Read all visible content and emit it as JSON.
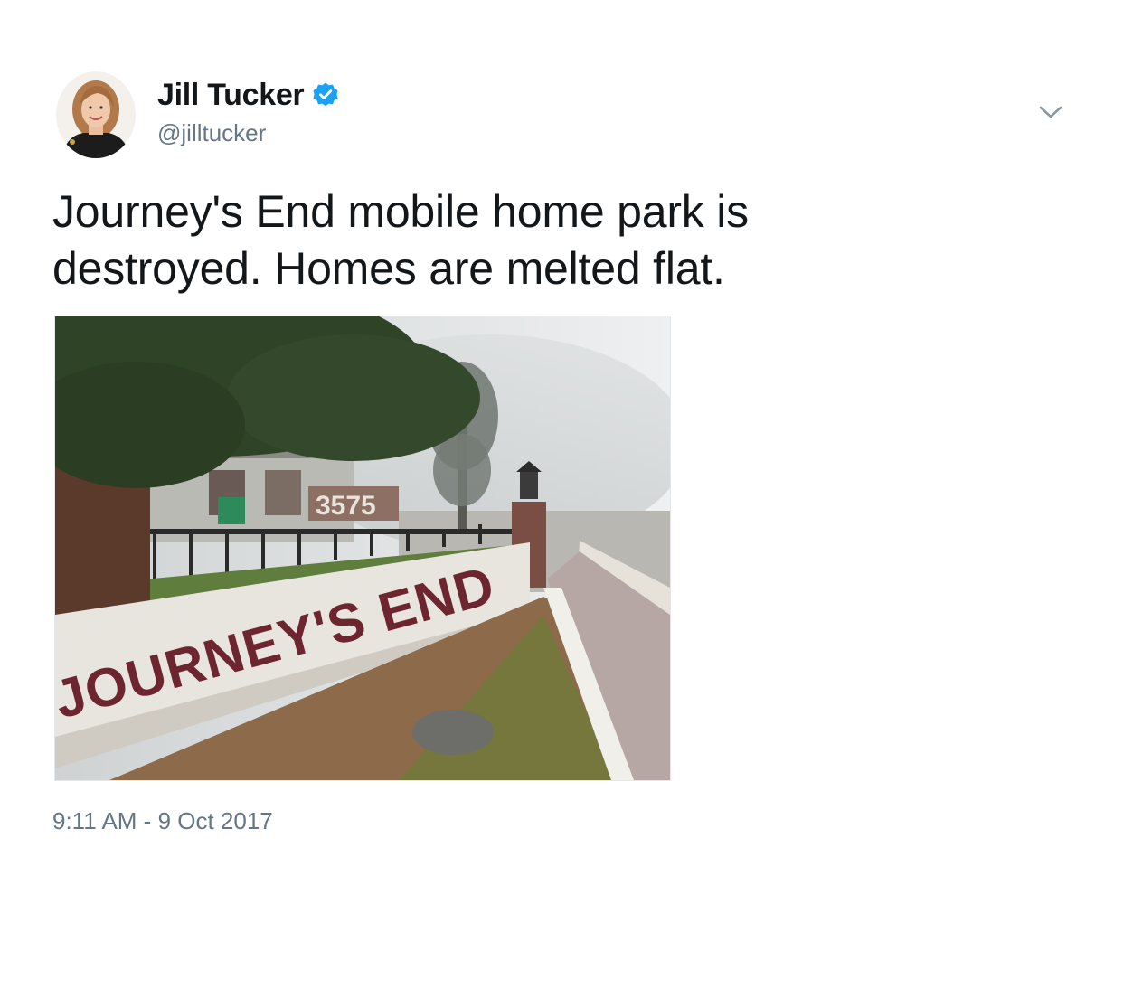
{
  "tweet": {
    "display_name": "Jill Tucker",
    "handle": "@jilltucker",
    "verified_icon": "verified-badge-icon",
    "text": "Journey's End mobile home park is destroyed. Homes are melted flat.",
    "timestamp": "9:11 AM - 9 Oct 2017",
    "menu_icon": "chevron-down-icon",
    "media": {
      "sign_text": "JOURNEY'S END",
      "address_number": "3575"
    }
  },
  "colors": {
    "text": "#14171a",
    "secondary": "#657786",
    "verified": "#1da1f2"
  }
}
